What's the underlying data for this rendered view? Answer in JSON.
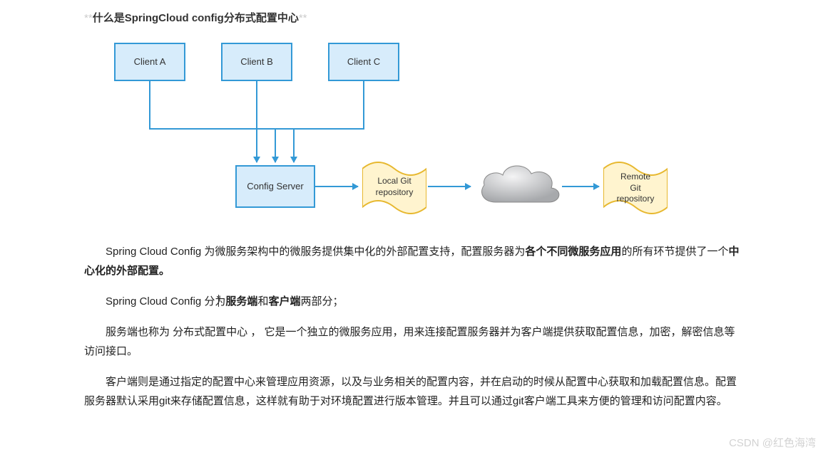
{
  "title": {
    "stars_left": "**",
    "text": "什么是SpringCloud config分布式配置中心",
    "stars_right": "**"
  },
  "diagram": {
    "clientA": "Client A",
    "clientB": "Client B",
    "clientC": "Client C",
    "configServer": "Config Server",
    "localGit": "Local Git\nrepository",
    "remoteGit": "Remote\nGit\nrepository"
  },
  "text": {
    "p1_a": "Spring Cloud Config 为微服务架构中的微服务提供集中化的外部配置支持，配置服务器为",
    "p1_b": "各个不同微服务应用",
    "p1_c": "的所有环节提供了一个",
    "p1_d": "中心化的外部配置。",
    "p2_a": "Spring Cloud  Config 分为",
    "p2_b": "服务端",
    "p2_c": "和",
    "p2_d": "客户端",
    "p2_e": "两部分；",
    "p3": "服务端也称为 分布式配置中心 ， 它是一个独立的微服务应用，用来连接配置服务器并为客户端提供获取配置信息，加密，解密信息等访问接口。",
    "p4": "客户端则是通过指定的配置中心来管理应用资源，以及与业务相关的配置内容，并在启动的时候从配置中心获取和加载配置信息。配置服务器默认采用git来存储配置信息，这样就有助于对环境配置进行版本管理。并且可以通过git客户端工具来方便的管理和访问配置内容。"
  },
  "watermark": "CSDN @红色海湾"
}
